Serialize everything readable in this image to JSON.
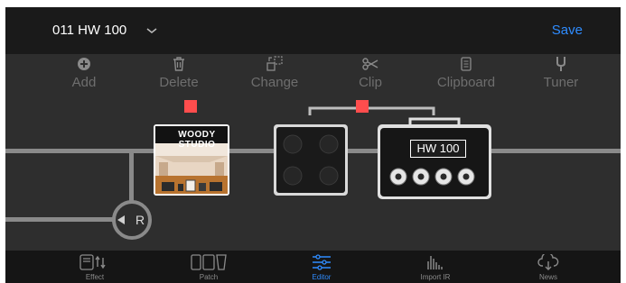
{
  "header": {
    "patch_name": "011 HW 100",
    "save_label": "Save"
  },
  "toolbar": {
    "items": [
      {
        "label": "Add",
        "icon": "plus-circle-icon"
      },
      {
        "label": "Delete",
        "icon": "trash-icon"
      },
      {
        "label": "Change",
        "icon": "swap-icon"
      },
      {
        "label": "Clip",
        "icon": "scissors-icon"
      },
      {
        "label": "Clipboard",
        "icon": "clipboard-icon"
      },
      {
        "label": "Tuner",
        "icon": "tuning-fork-icon"
      }
    ]
  },
  "chain": {
    "ir_title": "WOODY STUDIO",
    "amp_model": "HW 100",
    "return_label": "R"
  },
  "tabs": [
    {
      "label": "Effect",
      "icon": "effect-icon",
      "active": false
    },
    {
      "label": "Patch",
      "icon": "patch-icon",
      "active": false
    },
    {
      "label": "Editor",
      "icon": "sliders-icon",
      "active": true
    },
    {
      "label": "Import IR",
      "icon": "bar-graph-icon",
      "active": false
    },
    {
      "label": "News",
      "icon": "cloud-download-icon",
      "active": false
    }
  ],
  "colors": {
    "accent": "#2f8cff",
    "selection": "#ff4d4d",
    "background": "#2e2e2e"
  }
}
